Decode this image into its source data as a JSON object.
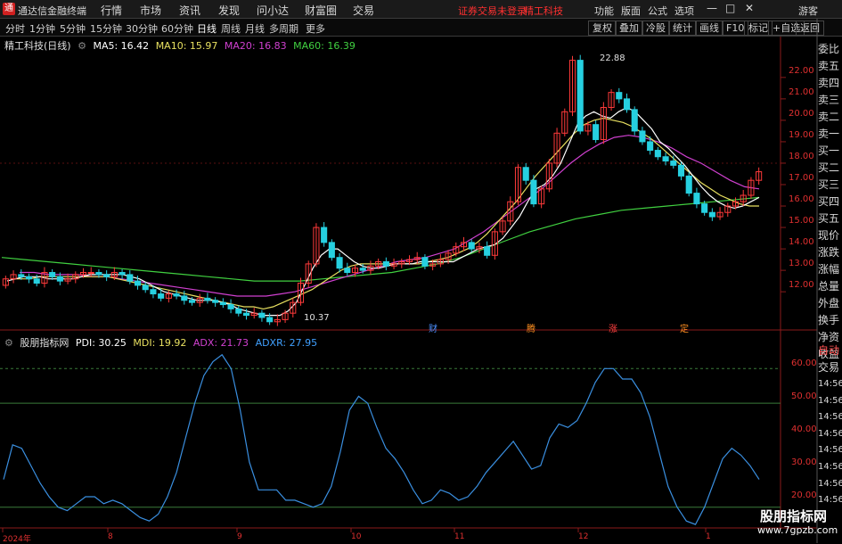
{
  "titlebar": {
    "app_title": "通达信金融终端",
    "menu": [
      "行情",
      "市场",
      "资讯",
      "发现",
      "问小达",
      "财富圈",
      "交易"
    ],
    "warning": "证券交易未登录",
    "stock_name": "精工科技",
    "right_menu": [
      "功能",
      "版面",
      "公式",
      "选项"
    ],
    "guest": "游客",
    "win_controls": [
      "—",
      "□",
      "✕"
    ]
  },
  "toolbar": {
    "timeframes": [
      "分时",
      "1分钟",
      "5分钟",
      "15分钟",
      "30分钟",
      "60分钟",
      "日线",
      "周线",
      "月线",
      "多周期",
      "更多"
    ],
    "active": "日线",
    "right_buttons": [
      "复权",
      "叠加",
      "冷股",
      "统计",
      "画线",
      "F10",
      "标记",
      "+自选",
      "返回"
    ]
  },
  "main_legend": {
    "title": "精工科技(日线)",
    "ma5": "MA5: 16.42",
    "ma10": "MA10: 15.97",
    "ma20": "MA20: 16.83",
    "ma60": "MA60: 16.39"
  },
  "indicator_legend": {
    "title": "股朋指标网",
    "pdi": "PDI: 30.25",
    "mdi": "MDI: 19.92",
    "adx": "ADX: 21.73",
    "adxr": "ADXR: 27.95"
  },
  "price_axis": [
    "22.00",
    "21.00",
    "20.00",
    "19.00",
    "18.00",
    "17.00",
    "16.00",
    "15.00",
    "14.00",
    "13.00",
    "12.00"
  ],
  "indicator_axis": [
    "60.00",
    "50.00",
    "40.00",
    "30.00",
    "20.00"
  ],
  "annotations": {
    "high": "22.88",
    "low": "10.37"
  },
  "events": [
    {
      "label": "财",
      "color": "#4a90ff"
    },
    {
      "label": "腾",
      "color": "#ff9020"
    },
    {
      "label": "涨",
      "color": "#ff4040"
    },
    {
      "label": "定",
      "color": "#ff9020"
    }
  ],
  "dates": [
    "2024年",
    "8",
    "9",
    "10",
    "11",
    "12",
    "1"
  ],
  "side_panel": [
    "委比",
    "卖五",
    "卖四",
    "卖三",
    "卖二",
    "卖一",
    "买一",
    "买二",
    "买三",
    "买四",
    "买五",
    "现价",
    "涨跌",
    "涨幅",
    "总量",
    "外盘",
    "换手",
    "净资",
    "收益"
  ],
  "side_panel2": [
    "自动",
    "交易"
  ],
  "time_labels": [
    "14:56",
    "14:56",
    "14:56",
    "14:56",
    "14:56",
    "14:56",
    "14:56",
    "14:56"
  ],
  "watermark": {
    "name": "股朋指标网",
    "url": "www.7gpzb.com"
  },
  "colors": {
    "up": "#ff3a3a",
    "down": "#26d0e0",
    "ma5": "#ffffff",
    "ma10": "#e8e060",
    "ma20": "#d040d0",
    "ma60": "#40d040",
    "pdi_line": "#3a8fe0",
    "axis": "#e03030"
  },
  "chart_data": {
    "type": "candlestick",
    "price_range": [
      10.3,
      23.2
    ],
    "candles_open": [
      12.3,
      12.6,
      12.8,
      12.7,
      12.6,
      12.4,
      12.9,
      12.7,
      12.5,
      12.6,
      12.8,
      12.9,
      12.9,
      12.8,
      12.7,
      12.9,
      12.8,
      12.5,
      12.3,
      12.1,
      11.9,
      11.7,
      11.9,
      11.8,
      11.6,
      11.5,
      11.7,
      11.6,
      11.5,
      11.4,
      11.2,
      11.0,
      10.9,
      11.0,
      10.8,
      10.6,
      10.7,
      11.0,
      11.5,
      12.4,
      13.3,
      15.0,
      14.3,
      13.6,
      13.1,
      12.9,
      13.1,
      13.0,
      13.2,
      13.4,
      13.2,
      13.3,
      13.4,
      13.5,
      13.6,
      13.2,
      13.3,
      13.5,
      13.8,
      14.1,
      14.3,
      14.0,
      14.1,
      13.7,
      14.8,
      15.3,
      16.2,
      17.8,
      17.2,
      16.1,
      16.8,
      18.0,
      19.4,
      20.4,
      22.8,
      19.5,
      19.8,
      19.1,
      20.6,
      21.3,
      21.0,
      20.5,
      19.5,
      19.0,
      18.6,
      18.3,
      18.1,
      17.9,
      17.4,
      16.6,
      16.1,
      15.7,
      15.5,
      15.7,
      16.0,
      16.2,
      16.5,
      17.2
    ],
    "candles_close": [
      12.6,
      12.8,
      12.7,
      12.6,
      12.4,
      12.9,
      12.7,
      12.5,
      12.6,
      12.8,
      12.9,
      12.9,
      12.8,
      12.7,
      12.9,
      12.8,
      12.5,
      12.3,
      12.1,
      11.9,
      11.7,
      11.9,
      11.8,
      11.6,
      11.5,
      11.7,
      11.6,
      11.5,
      11.4,
      11.2,
      11.0,
      10.9,
      11.0,
      10.8,
      10.6,
      10.7,
      11.0,
      11.5,
      12.4,
      13.3,
      15.0,
      14.3,
      13.6,
      13.1,
      12.9,
      13.1,
      13.0,
      13.2,
      13.4,
      13.2,
      13.3,
      13.4,
      13.5,
      13.6,
      13.2,
      13.3,
      13.5,
      13.8,
      14.1,
      14.3,
      14.0,
      14.1,
      13.7,
      14.8,
      15.3,
      16.2,
      17.8,
      17.2,
      16.1,
      16.8,
      18.0,
      19.4,
      20.4,
      22.8,
      19.5,
      19.8,
      19.1,
      20.6,
      21.3,
      21.0,
      20.5,
      19.5,
      19.0,
      18.6,
      18.3,
      18.1,
      17.9,
      17.4,
      16.6,
      16.1,
      15.7,
      15.5,
      15.7,
      16.0,
      16.2,
      16.5,
      17.2,
      17.6
    ],
    "ma5": [
      12.5,
      12.6,
      12.7,
      12.7,
      12.7,
      12.6,
      12.6,
      12.6,
      12.6,
      12.7,
      12.8,
      12.8,
      12.8,
      12.8,
      12.8,
      12.7,
      12.6,
      12.4,
      12.2,
      12.0,
      11.9,
      11.8,
      11.7,
      11.6,
      11.6,
      11.6,
      11.5,
      11.4,
      11.2,
      11.1,
      11.0,
      10.9,
      10.9,
      10.9,
      11.1,
      11.5,
      12.3,
      13.1,
      13.7,
      14.0,
      14.0,
      13.7,
      13.4,
      13.2,
      13.1,
      13.1,
      13.2,
      13.3,
      13.3,
      13.3,
      13.4,
      13.4,
      13.4,
      13.4,
      13.4,
      13.6,
      13.8,
      14.0,
      14.1,
      14.2,
      14.5,
      15.0,
      15.5,
      16.2,
      16.8,
      17.0,
      17.4,
      18.0,
      18.9,
      19.8,
      20.2,
      20.4,
      20.2,
      20.1,
      20.4,
      20.6,
      20.4,
      20.0,
      19.6,
      19.0,
      18.7,
      18.3,
      17.9,
      17.4,
      16.9,
      16.5,
      16.2,
      16.0,
      15.9,
      16.0,
      16.2,
      16.4
    ],
    "ma10": [
      12.6,
      12.6,
      12.6,
      12.7,
      12.7,
      12.7,
      12.7,
      12.7,
      12.7,
      12.7,
      12.7,
      12.6,
      12.5,
      12.4,
      12.3,
      12.2,
      12.1,
      12.0,
      11.9,
      11.8,
      11.7,
      11.6,
      11.5,
      11.4,
      11.3,
      11.3,
      11.2,
      11.3,
      11.5,
      11.7,
      11.9,
      12.1,
      12.4,
      12.7,
      13.0,
      13.2,
      13.3,
      13.3,
      13.3,
      13.3,
      13.3,
      13.3,
      13.3,
      13.4,
      13.5,
      13.6,
      13.8,
      14.0,
      14.3,
      14.7,
      15.2,
      15.7,
      16.2,
      16.8,
      17.4,
      17.9,
      18.4,
      18.9,
      19.4,
      19.8,
      20.0,
      20.1,
      20.0,
      19.9,
      19.7,
      19.4,
      19.1,
      18.7,
      18.3,
      17.9,
      17.5,
      17.1,
      16.8,
      16.5,
      16.3,
      16.1,
      16.0,
      16.0
    ],
    "ma20": [
      12.9,
      12.9,
      12.8,
      12.8,
      12.8,
      12.7,
      12.7,
      12.6,
      12.5,
      12.4,
      12.3,
      12.2,
      12.1,
      12.0,
      11.9,
      11.8,
      11.8,
      11.8,
      11.9,
      12.0,
      12.2,
      12.4,
      12.6,
      12.8,
      13.0,
      13.2,
      13.4,
      13.5,
      13.6,
      13.8,
      14.0,
      14.4,
      14.8,
      15.3,
      15.8,
      16.3,
      16.8,
      17.4,
      18.0,
      18.5,
      18.9,
      19.2,
      19.3,
      19.2,
      19.0,
      18.7,
      18.3,
      18.0,
      17.6,
      17.2,
      16.9,
      16.8
    ],
    "ma60": [
      13.6,
      13.5,
      13.4,
      13.3,
      13.2,
      13.1,
      13.0,
      12.9,
      12.8,
      12.7,
      12.6,
      12.5,
      12.5,
      12.5,
      12.6,
      12.7,
      12.8,
      12.9,
      13.1,
      13.3,
      13.6,
      14.0,
      14.4,
      14.8,
      15.1,
      15.4,
      15.6,
      15.8,
      15.9,
      16.0,
      16.1,
      16.2,
      16.3,
      16.4
    ],
    "indicator_range": [
      14,
      66
    ],
    "pdi": [
      28,
      38,
      37,
      32,
      27,
      23,
      20,
      19,
      21,
      23,
      23,
      21,
      22,
      21,
      19,
      17,
      16,
      18,
      23,
      30,
      40,
      50,
      58,
      62,
      64,
      60,
      48,
      33,
      25,
      25,
      25,
      22,
      22,
      21,
      20,
      21,
      26,
      36,
      48,
      52,
      50,
      43,
      37,
      34,
      30,
      25,
      21,
      22,
      25,
      24,
      22,
      23,
      26,
      30,
      33,
      36,
      39,
      35,
      31,
      32,
      40,
      44,
      43,
      45,
      50,
      56,
      60,
      60,
      57,
      57,
      53,
      46,
      36,
      26,
      20,
      16,
      15,
      20,
      27,
      34,
      37,
      35,
      32,
      28
    ]
  }
}
